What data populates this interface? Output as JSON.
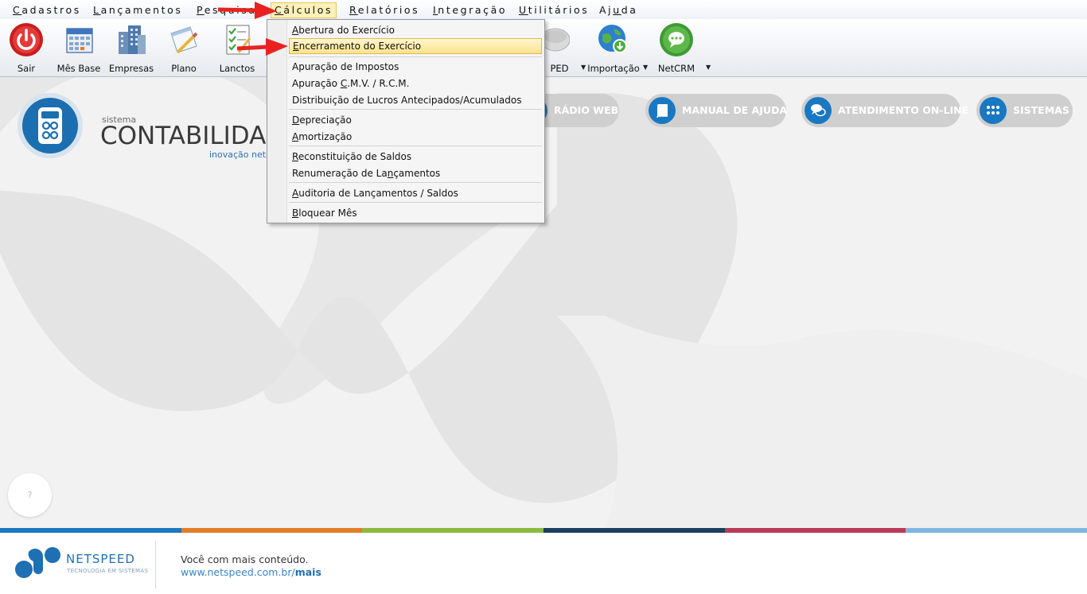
{
  "menubar": {
    "items": [
      {
        "label": "Cadastros",
        "ul": "C",
        "rest": "adastros"
      },
      {
        "label": "Lançamentos",
        "ul": "L",
        "rest": "ançamentos"
      },
      {
        "label": "Pesquisas",
        "ul": "P",
        "rest": "esquisas"
      },
      {
        "label": "Cálculos",
        "ul": "C",
        "rest": "álculos"
      },
      {
        "label": "Relatórios",
        "ul": "R",
        "rest": "elatórios"
      },
      {
        "label": "Integração",
        "ul": "I",
        "rest": "ntegração"
      },
      {
        "label": "Utilitários",
        "ul": "U",
        "rest": "tilitários"
      },
      {
        "label": "Ajuda",
        "pre": "Aj",
        "ul": "u",
        "rest": "da"
      }
    ]
  },
  "toolbar": {
    "buttons": [
      {
        "label": "Sair",
        "icon": "power-icon"
      },
      {
        "label": "Mês Base",
        "icon": "calendar-icon"
      },
      {
        "label": "Empresas",
        "icon": "buildings-icon"
      },
      {
        "label": "Plano",
        "icon": "document-pencil-icon"
      },
      {
        "label": "Lanctos",
        "icon": "checklist-icon"
      },
      {
        "label": "SPED",
        "icon": "sped-icon"
      },
      {
        "label": "Importação",
        "icon": "globe-download-icon"
      },
      {
        "label": "NetCRM",
        "icon": "chat-bubble-icon"
      }
    ]
  },
  "dropdown": {
    "groups": [
      [
        {
          "pre": "",
          "ul": "A",
          "rest": "bertura do Exercício",
          "highlighted": false
        },
        {
          "pre": "",
          "ul": "E",
          "rest": "ncerramento do Exercício",
          "highlighted": true
        }
      ],
      [
        {
          "pre": "",
          "ul": "",
          "rest": "Apuração de Impostos",
          "highlighted": false
        },
        {
          "pre": "Apuração ",
          "ul": "C",
          "rest": ".M.V. / R.C.M.",
          "highlighted": false
        },
        {
          "pre": "",
          "ul": "",
          "rest": "Distribuição de Lucros Antecipados/Acumulados",
          "highlighted": false
        }
      ],
      [
        {
          "pre": "",
          "ul": "D",
          "rest": "epreciação",
          "highlighted": false
        },
        {
          "pre": "",
          "ul": "A",
          "rest": "mortização",
          "highlighted": false
        }
      ],
      [
        {
          "pre": "",
          "ul": "R",
          "rest": "econstituição de Saldos",
          "highlighted": false
        },
        {
          "pre": "Renumeração de La",
          "ul": "n",
          "rest": "çamentos",
          "highlighted": false
        }
      ],
      [
        {
          "pre": "",
          "ul": "A",
          "rest": "uditoria de Lançamentos / Saldos",
          "highlighted": false
        }
      ],
      [
        {
          "pre": "",
          "ul": "B",
          "rest": "loquear Mês",
          "highlighted": false
        }
      ]
    ]
  },
  "brand": {
    "small": "sistema",
    "big": "CONTABILIDADE",
    "sub": "inovação netspeed"
  },
  "pills": [
    {
      "label": "RÁDIO WEB",
      "icon": "radio-icon"
    },
    {
      "label": "MANUAL DE AJUDA",
      "icon": "book-icon"
    },
    {
      "label": "ATENDIMENTO ON-LINE",
      "icon": "chat-icon"
    },
    {
      "label": "SISTEMAS",
      "icon": "grid-dots-icon"
    }
  ],
  "help": {
    "label": "?"
  },
  "strip_colors": [
    "#1a78c2",
    "#e27d27",
    "#8bba3f",
    "#1d3f5e",
    "#b83a55",
    "#7fb6e0"
  ],
  "footer": {
    "brand": "NETSPEED",
    "tagline": "TECNOLOGIA EM SISTEMAS",
    "line1": "Você com mais conteúdo.",
    "url_base": "www.netspeed.com.br/",
    "url_bold": "mais"
  }
}
